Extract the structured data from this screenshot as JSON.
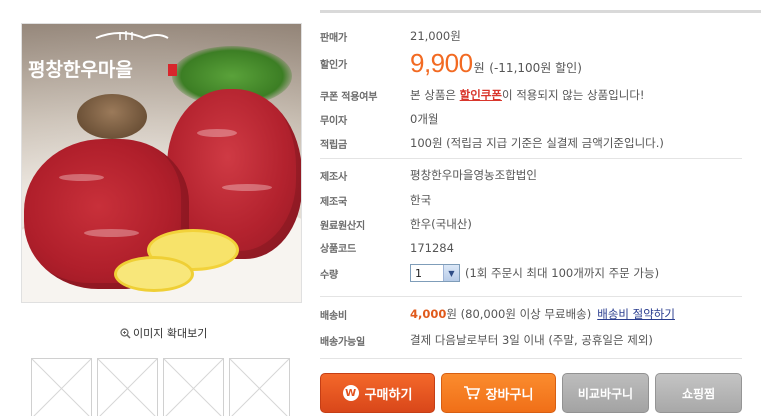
{
  "image": {
    "logo_text": "평창한우마을",
    "zoom_label": "이미지 확대보기",
    "thumbnails": 4
  },
  "info": {
    "list_price": {
      "label": "판매가",
      "value": "21,000원"
    },
    "sale_price": {
      "label": "할인가",
      "amount": "9,900",
      "unit": "원",
      "discount": "(-11,100원 할인)"
    },
    "coupon": {
      "label": "쿠폰 적용여부",
      "prefix": "본 상품은 ",
      "emphasis": "할인쿠폰",
      "suffix": "이 적용되지 않는 상품입니다!"
    },
    "installment": {
      "label": "무이자",
      "value": "0개월"
    },
    "points": {
      "label": "적립금",
      "value": "100원 (적립금 지급 기준은 실결제 금액기준입니다.)"
    },
    "maker": {
      "label": "제조사",
      "value": "평창한우마을영농조합법인"
    },
    "country": {
      "label": "제조국",
      "value": "한국"
    },
    "origin": {
      "label": "원료원산지",
      "value": "한우(국내산)"
    },
    "code": {
      "label": "상품코드",
      "value": "171284"
    },
    "quantity": {
      "label": "수량",
      "selected": "1",
      "note": "(1회 주문시 최대 100개까지 주문 가능)"
    },
    "shipping": {
      "label": "배송비",
      "price": "4,000",
      "unit": "원",
      "note": " (80,000원 이상 무료배송)",
      "link": "배송비 절약하기"
    },
    "delivery": {
      "label": "배송가능일",
      "value": "결제 다음날로부터 3일 이내 (주말, 공휴일은 제외)"
    }
  },
  "buttons": {
    "buy": "구매하기",
    "cart": "장바구니",
    "compare": "비교바구니",
    "shop": "쇼핑찜"
  },
  "colors": {
    "accent_price": "#f26a22",
    "buy_button": "#e2521e",
    "cart_button": "#f47b22",
    "gray_button": "#b0b0b0"
  }
}
